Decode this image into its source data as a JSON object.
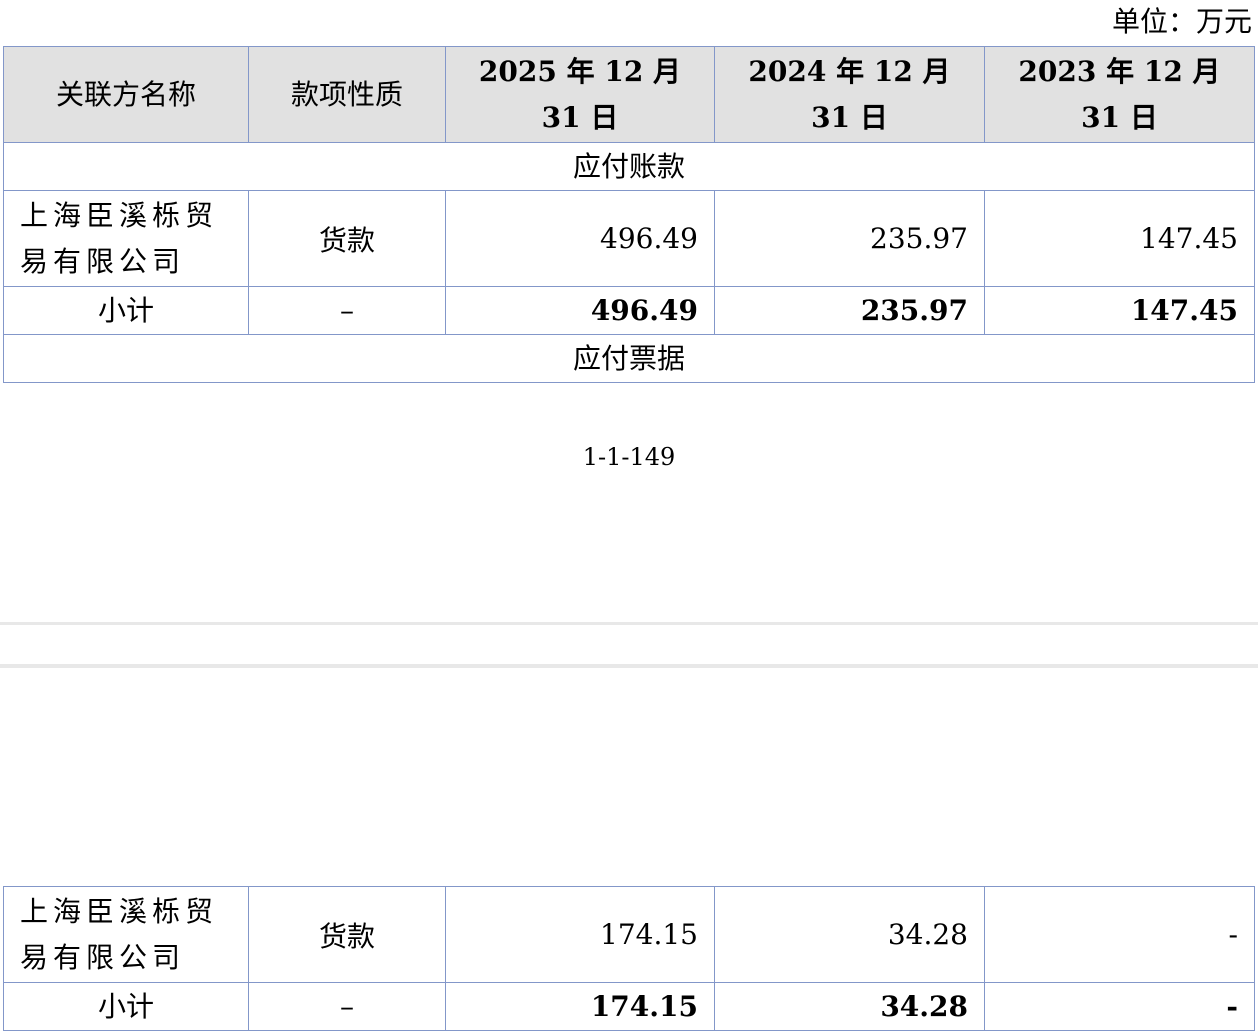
{
  "unit_label": "单位：万元",
  "headers": [
    "关联方名称",
    "款项性质",
    "2025 年 12 月 31 日",
    "2024 年 12 月 31 日",
    "2023 年 12 月 31 日"
  ],
  "sections": {
    "payables": {
      "title": "应付账款",
      "row": {
        "name": "上海臣溪栎贸易有限公司",
        "nature": "货款",
        "v2025": "496.49",
        "v2024": "235.97",
        "v2023": "147.45"
      },
      "subtotal": {
        "label": "小计",
        "nature": "–",
        "v2025": "496.49",
        "v2024": "235.97",
        "v2023": "147.45"
      }
    },
    "notes": {
      "title": "应付票据",
      "row": {
        "name": "上海臣溪栎贸易有限公司",
        "nature": "货款",
        "v2025": "174.15",
        "v2024": "34.28",
        "v2023": "-"
      },
      "subtotal": {
        "label": "小计",
        "nature": "–",
        "v2025": "174.15",
        "v2024": "34.28",
        "v2023": "-"
      }
    }
  },
  "page_number": "1-1-149"
}
